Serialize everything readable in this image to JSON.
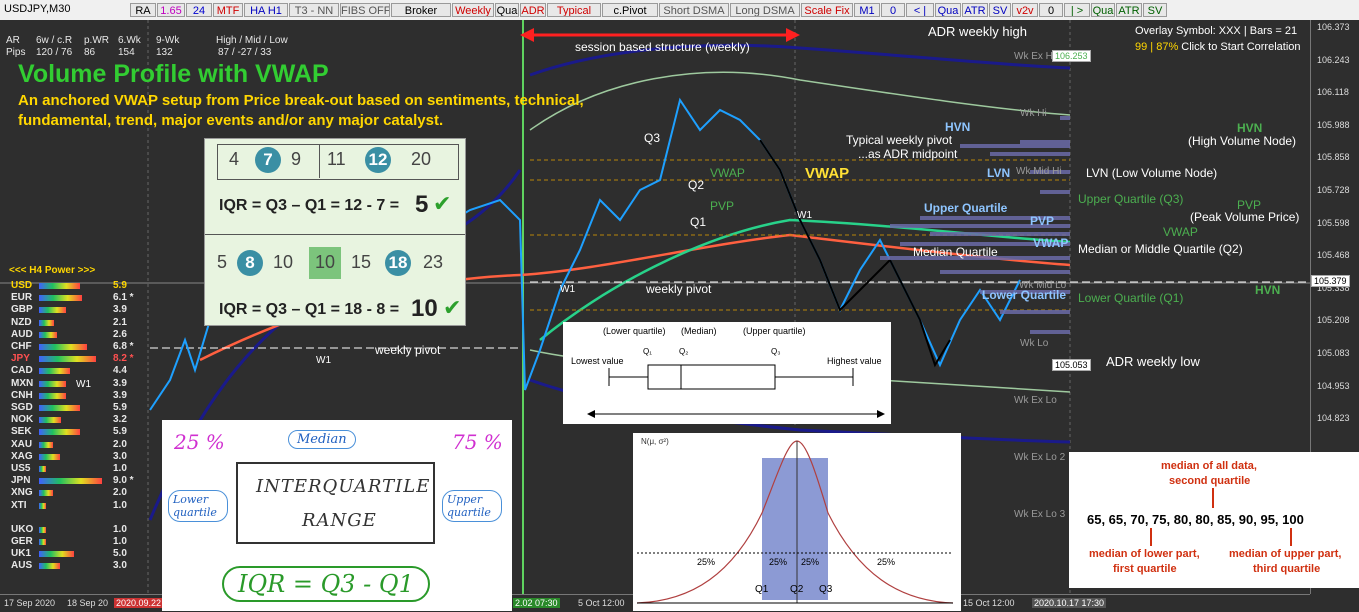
{
  "toolbar": {
    "symbol": "USDJPY,M30",
    "buttons": [
      {
        "label": "RA",
        "color": "#000"
      },
      {
        "label": "1.65",
        "color": "#c000c0"
      },
      {
        "label": "24",
        "color": "#0000d0"
      },
      {
        "label": "MTF",
        "color": "#d00000"
      },
      {
        "label": "HA H1",
        "color": "#0000c0"
      },
      {
        "label": "T3 - NN",
        "color": "#555"
      },
      {
        "label": "FIBS OFF",
        "color": "#555"
      },
      {
        "label": "Broker",
        "color": "#000"
      },
      {
        "label": "Weekly",
        "color": "#d00000"
      },
      {
        "label": "Qua",
        "color": "#000"
      },
      {
        "label": "ADR",
        "color": "#d00000"
      },
      {
        "label": "Typical",
        "color": "#d00000"
      },
      {
        "label": "c.Pivot",
        "color": "#000"
      },
      {
        "label": "Short DSMA",
        "color": "#555"
      },
      {
        "label": "Long DSMA",
        "color": "#555"
      },
      {
        "label": "Scale Fix",
        "color": "#d00000"
      },
      {
        "label": "M1",
        "color": "#0000c0"
      },
      {
        "label": "0",
        "color": "#0000c0"
      },
      {
        "label": "< |",
        "color": "#0000c0"
      },
      {
        "label": "Qua",
        "color": "#0000c0"
      },
      {
        "label": "ATR",
        "color": "#0000c0"
      },
      {
        "label": "SV",
        "color": "#0000c0"
      },
      {
        "label": "v2v",
        "color": "#d00000"
      },
      {
        "label": "0",
        "color": "#000"
      },
      {
        "label": "| >",
        "color": "#006000"
      },
      {
        "label": "Qua",
        "color": "#006000"
      },
      {
        "label": "ATR",
        "color": "#006000"
      },
      {
        "label": "SV",
        "color": "#006000"
      }
    ]
  },
  "stats": {
    "header": [
      "AR",
      "6w / c.R",
      "p.WR",
      "6.Wk",
      "9-Wk",
      "High / Mid / Low"
    ],
    "row_label": "Pips",
    "values": [
      "120 / 76",
      "86",
      "154",
      "132",
      "87 / -27 / 33"
    ]
  },
  "overlay": {
    "symbol_line": "Overlay Symbol: XXX  |  Bars = 21",
    "corr_line_value": "99 | 87%",
    "corr_line_text": "Click to Start Correlation"
  },
  "title": "Volume Profile with VWAP",
  "subtitle_line1": "An anchored VWAP setup from Price break-out based on sentiments, technical,",
  "subtitle_line2": "fundamental, trend, major events and/or any major catalyst.",
  "annotations": {
    "session": "session based structure (weekly)",
    "adr_high": "ADR weekly high",
    "adr_low": "ADR weekly low",
    "typical_pivot_1": "Typical weekly pivot",
    "typical_pivot_2": "...as ADR midpoint",
    "vwap_big": "VWAP",
    "weekly_pivot": "weekly pivot",
    "weekly_pivot_left": "weekly pivot",
    "hvn": "HVN",
    "hvn_desc": "(High Volume Node)",
    "lvn": "LVN",
    "lvn_desc": "LVN (Low Volume Node)",
    "upper_q": "Upper Quartile",
    "upper_q_desc": "Upper Quartile (Q3)",
    "pvp": "PVP",
    "pvp_desc": "(Peak Volume Price)",
    "vwap_r": "VWAP",
    "median_q": "Median Quartile",
    "median_desc": "Median or Middle Quartile (Q2)",
    "lower_q": "Lower Quartile",
    "lower_q_desc": "Lower Quartile (Q1)",
    "hvn2": "HVN",
    "q1": "Q1",
    "q2": "Q2",
    "q3": "Q3",
    "w1": "W1",
    "vwap_mid": "VWAP",
    "pvp_mid": "PVP",
    "wk_ex_hi": "Wk Ex Hi",
    "wk_hi": "Wk Hi",
    "wk_mid_hi": "Wk Mid Hi",
    "wk_mid_lo": "Wk Mid Lo",
    "wk_lo": "Wk Lo",
    "wk_ex_lo": "Wk Ex Lo",
    "wk_ex_lo2": "Wk Ex Lo 2",
    "wk_ex_lo3": "Wk Ex Lo 3"
  },
  "prices": {
    "ticks": [
      "106.373",
      "106.243",
      "106.118",
      "105.988",
      "105.858",
      "105.728",
      "105.598",
      "105.468",
      "105.338",
      "105.208",
      "105.083",
      "104.953",
      "104.823"
    ],
    "current": "105.379",
    "tag_high": "106.253",
    "tag_low": "105.053"
  },
  "dates": [
    "17 Sep 2020",
    "18 Sep 20",
    "2020.09.22",
    "5 Oct 12:00",
    "15 Oct 12:00",
    "2020.10.17 17:30"
  ],
  "date_mid": "2.02 07:30",
  "power": {
    "header": "<<<  H4  Power  >>>",
    "rows": [
      {
        "cur": "USD",
        "val": "5.9",
        "color": "#ffd700"
      },
      {
        "cur": "EUR",
        "val": "6.1 *",
        "color": "#e8e8e8"
      },
      {
        "cur": "GBP",
        "val": "3.9",
        "color": "#e8e8e8"
      },
      {
        "cur": "NZD",
        "val": "2.1",
        "color": "#e8e8e8"
      },
      {
        "cur": "AUD",
        "val": "2.6",
        "color": "#e8e8e8"
      },
      {
        "cur": "CHF",
        "val": "6.8 *",
        "color": "#e8e8e8"
      },
      {
        "cur": "JPY",
        "val": "8.2 *",
        "color": "#ff5050"
      },
      {
        "cur": "CAD",
        "val": "4.4",
        "color": "#e8e8e8"
      },
      {
        "cur": "MXN",
        "val": "3.9",
        "color": "#e8e8e8"
      },
      {
        "cur": "CNH",
        "val": "3.9",
        "color": "#e8e8e8"
      },
      {
        "cur": "SGD",
        "val": "5.9",
        "color": "#e8e8e8"
      },
      {
        "cur": "NOK",
        "val": "3.2",
        "color": "#e8e8e8"
      },
      {
        "cur": "SEK",
        "val": "5.9",
        "color": "#e8e8e8"
      },
      {
        "cur": "XAU",
        "val": "2.0",
        "color": "#e8e8e8"
      },
      {
        "cur": "XAG",
        "val": "3.0",
        "color": "#e8e8e8"
      },
      {
        "cur": "US5",
        "val": "1.0",
        "color": "#e8e8e8"
      },
      {
        "cur": "JPN",
        "val": "9.0 *",
        "color": "#e8e8e8"
      },
      {
        "cur": "XNG",
        "val": "2.0",
        "color": "#e8e8e8"
      },
      {
        "cur": "XTI",
        "val": "1.0",
        "color": "#e8e8e8"
      },
      {
        "cur": "UKO",
        "val": "1.0",
        "color": "#e8e8e8"
      },
      {
        "cur": "GER",
        "val": "1.0",
        "color": "#e8e8e8"
      },
      {
        "cur": "UK1",
        "val": "5.0",
        "color": "#e8e8e8"
      },
      {
        "cur": "AUS",
        "val": "3.0",
        "color": "#e8e8e8"
      }
    ]
  },
  "iqr_card": {
    "seq1": [
      "4",
      "7",
      "9",
      "11",
      "12",
      "20"
    ],
    "eq1_prefix": "IQR = Q3 – Q1 = 12 - 7 =",
    "eq1_result": "5",
    "seq2": [
      "5",
      "8",
      "10",
      "10",
      "15",
      "18",
      "23"
    ],
    "eq2_prefix": "IQR = Q3 – Q1 = 18 - 8 =",
    "eq2_result": "10"
  },
  "boxplot": {
    "lower_q": "(Lower quartile)",
    "median": "(Median)",
    "upper_q": "(Upper quartile)",
    "q1": "Q₁",
    "q2": "Q₂",
    "q3": "Q₃",
    "lowest": "Lowest value",
    "highest": "Highest value"
  },
  "whiteboard": {
    "p25": "25 %",
    "p75": "75 %",
    "median": "Median",
    "lower": "Lower quartile",
    "upper": "Upper quartile",
    "title1": "INTERQUARTILE",
    "title2": "RANGE",
    "formula": "IQR = Q3 - Q1"
  },
  "normal": {
    "label": "N(μ, σ²)",
    "pct_left": "25%",
    "pct_c1": "25%",
    "pct_c2": "25%",
    "pct_right": "25%",
    "q1": "Q1",
    "q2": "Q2",
    "q3": "Q3"
  },
  "quartile_example": {
    "top1": "median of all data,",
    "top2": "second quartile",
    "numbers": "65, 65, 70, 75, 80, 80, 85, 90, 95, 100",
    "bl1": "median of lower part,",
    "bl2": "first quartile",
    "br1": "median of upper part,",
    "br2": "third quartile"
  }
}
